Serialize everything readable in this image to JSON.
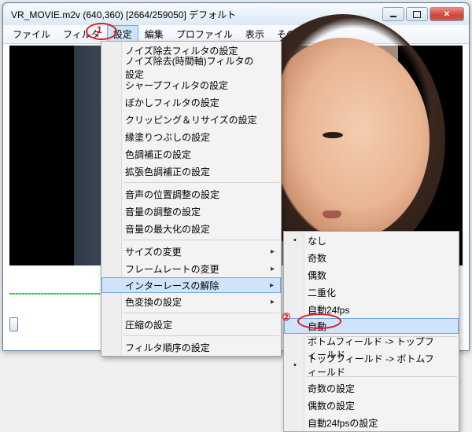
{
  "window": {
    "title": "VR_MOVIE.m2v (640,360)  [2664/259050]  デフォルト"
  },
  "menubar": {
    "file": "ファイル",
    "filter": "フィルタ",
    "settings": "設定",
    "edit": "編集",
    "profile": "プロファイル",
    "view": "表示",
    "other": "その他"
  },
  "annotations": {
    "one": "1",
    "two": "②"
  },
  "settings_menu": {
    "noise_filter": "ノイズ除去フィルタの設定",
    "noise_temporal": "ノイズ除去(時間軸)フィルタの設定",
    "sharpen": "シャープフィルタの設定",
    "blur": "ぼかしフィルタの設定",
    "clip_resize": "クリッピング＆リサイズの設定",
    "edge_fill": "縁塗りつぶしの設定",
    "color_correction": "色調補正の設定",
    "ext_color_correction": "拡張色調補正の設定",
    "audio_position": "音声の位置調整の設定",
    "volume_adjust": "音量の調整の設定",
    "volume_max": "音量の最大化の設定",
    "resize": "サイズの変更",
    "framerate": "フレームレートの変更",
    "interlace": "インターレースの解除",
    "color_convert": "色変換の設定",
    "compression": "圧縮の設定",
    "filter_order": "フィルタ順序の設定"
  },
  "interlace_submenu": {
    "none": "なし",
    "odd": "奇数",
    "even": "偶数",
    "double": "二重化",
    "auto24": "自動24fps",
    "auto": "自動",
    "bottom_top": "ボトムフィールド -> トップフィールド",
    "top_bottom": "トップフィールド -> ボトムフィールド",
    "odd_settings": "奇数の設定",
    "even_settings": "偶数の設定",
    "auto24_settings": "自動24fpsの設定"
  }
}
